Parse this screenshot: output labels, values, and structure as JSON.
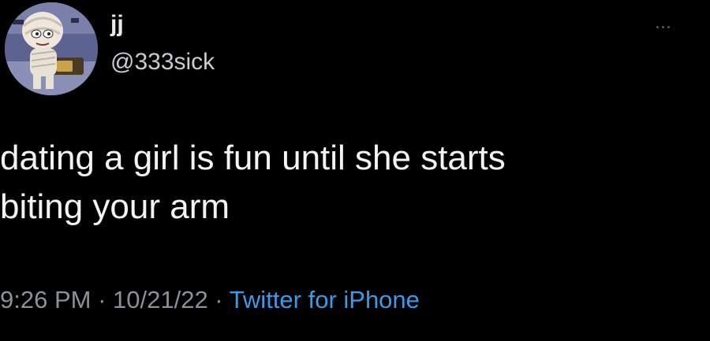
{
  "tweet": {
    "display_name": "jj",
    "handle": "@333sick",
    "more_icon": "more-horizontal-icon",
    "avatar_icon": "cartoon-avatar",
    "text": "dating a girl is fun until she starts\nbiting your arm",
    "time": "9:26 PM",
    "separator": " · ",
    "date": "10/21/22",
    "source": "Twitter for iPhone"
  },
  "colors": {
    "background": "#000000",
    "text": "#e7e9ea",
    "secondary": "#8b9196",
    "link": "#3a9be8"
  }
}
